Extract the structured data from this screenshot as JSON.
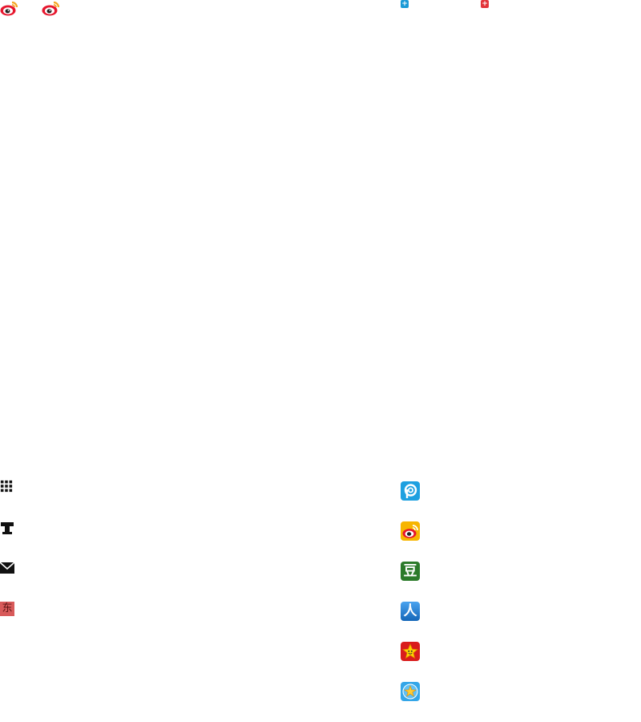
{
  "top": {
    "weibo_icons": [
      "weibo-logo",
      "weibo-logo"
    ],
    "plus_buttons": [
      {
        "icon": "plus-icon",
        "color": "#1a9ad6"
      },
      {
        "icon": "plus-icon",
        "color": "#e2343a"
      }
    ]
  },
  "left_icons": [
    "grid-icon",
    "text-icon",
    "mail-icon",
    "dong-icon"
  ],
  "dong_char": "东",
  "right_apps": [
    {
      "name": "pengyou-app-icon",
      "color": "#1ea0e0"
    },
    {
      "name": "weibo-app-icon",
      "color": "#f7b500"
    },
    {
      "name": "douban-app-icon",
      "color": "#2b7a2a",
      "char": "豆"
    },
    {
      "name": "renren-app-icon",
      "color": "#1979cf",
      "char": "人"
    },
    {
      "name": "kaixin-app-icon",
      "color": "#d91c1c"
    },
    {
      "name": "qzone-app-icon",
      "color": "#34a6e8"
    }
  ]
}
